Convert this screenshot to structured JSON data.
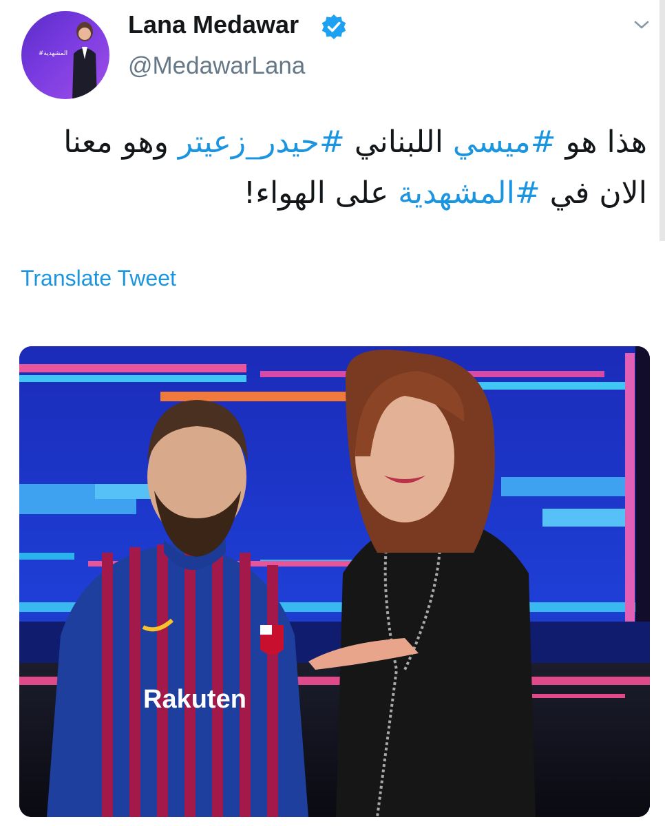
{
  "author": {
    "name": "Lana Medawar",
    "handle": "@MedawarLana",
    "avatar_brand_text": "#المشهدية",
    "verified_icon": "verified-badge-icon",
    "verified_color": "#1da1f2"
  },
  "tweet": {
    "text_parts": [
      {
        "text": "هذا هو "
      },
      {
        "text": "#ميسي",
        "hashtag": true
      },
      {
        "text": " اللبناني "
      },
      {
        "text": "#حيدر_زعيتر",
        "hashtag": true
      },
      {
        "text": " وهو معنا الان في "
      },
      {
        "text": "#المشهدية",
        "hashtag": true
      },
      {
        "text": " على الهواء!"
      }
    ],
    "translate_label": "Translate Tweet",
    "link_color": "#1b95e0"
  },
  "media": {
    "jersey_sponsor": "Rakuten"
  }
}
